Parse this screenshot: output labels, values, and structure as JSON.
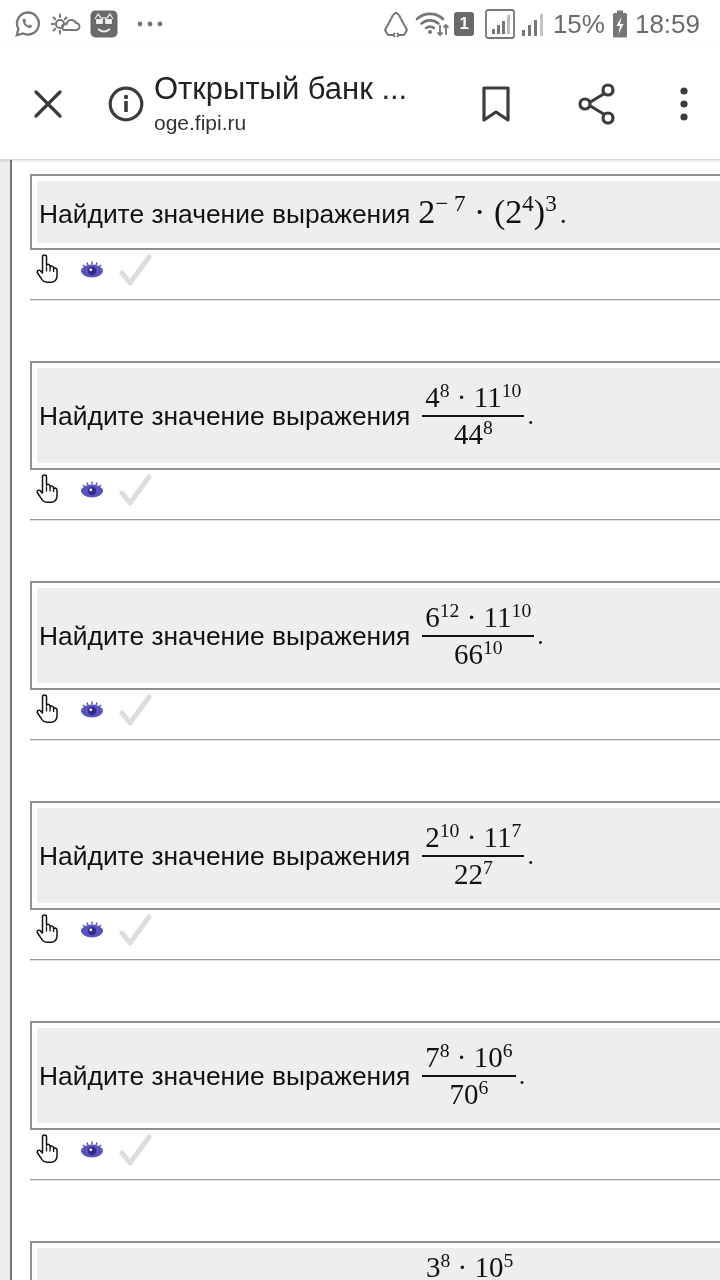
{
  "status_bar": {
    "sim_slot": "1",
    "battery": "15%",
    "time": "18:59"
  },
  "toolbar": {
    "title": "Открытый банк ...",
    "url": "oge.fipi.ru"
  },
  "tasks": [
    {
      "kind": "inline",
      "prompt": "Найдите значение выражения",
      "expression": "2$^{− 7}$ · (2$^{4}$)$^{3}$",
      "end": ".",
      "actions": {
        "check_disabled": true
      }
    },
    {
      "kind": "fraction",
      "prompt": "Найдите значение выражения",
      "numerator": "4$^{8}$ · 11$^{10}$",
      "denominator": "44$^{8}$",
      "end": ".",
      "actions": {
        "check_disabled": true
      }
    },
    {
      "kind": "fraction",
      "prompt": "Найдите значение выражения",
      "numerator": "6$^{12}$ · 11$^{10}$",
      "denominator": "66$^{10}$",
      "end": ".",
      "actions": {
        "check_disabled": true
      }
    },
    {
      "kind": "fraction",
      "prompt": "Найдите значение выражения",
      "numerator": "2$^{10}$ · 11$^{7}$",
      "denominator": "22$^{7}$",
      "end": ".",
      "actions": {
        "check_disabled": true
      }
    },
    {
      "kind": "fraction",
      "prompt": "Найдите значение выражения",
      "numerator": "7$^{8}$ · 10$^{6}$",
      "denominator": "70$^{6}$",
      "end": ".",
      "actions": {
        "check_disabled": true
      }
    },
    {
      "kind": "fraction_top",
      "numerator": "3$^{8}$ · 10$^{5}$"
    }
  ]
}
